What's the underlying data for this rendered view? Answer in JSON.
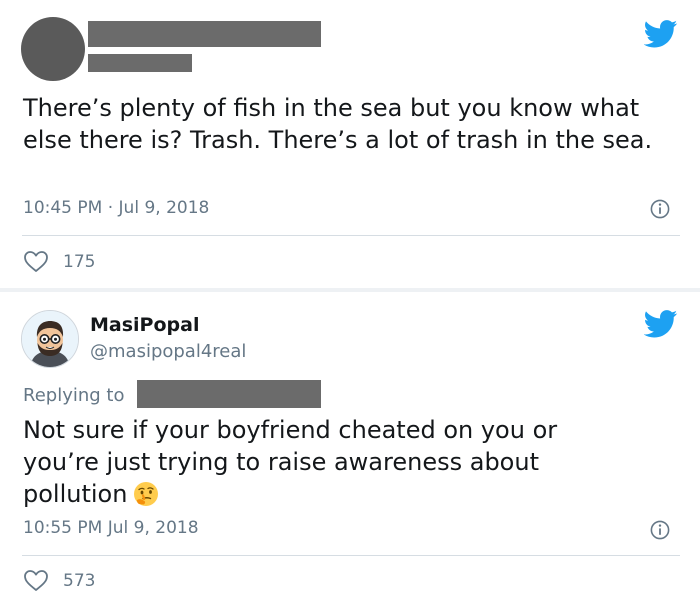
{
  "tweet1": {
    "text": "There’s plenty of fish in the sea but you know what else there is? Trash. There’s a lot of trash in the sea.",
    "time": "10:45 PM",
    "separator": "·",
    "date": "Jul 9, 2018",
    "likes": "175"
  },
  "tweet2": {
    "display_name": "MasiPopal",
    "handle": "@masipopal4real",
    "replying_to_label": "Replying to",
    "text": "Not sure if your boyfriend cheated on you or you’re just trying to raise awareness about pollution",
    "emoji": "thinking-face",
    "time": "10:55 PM",
    "date": "Jul 9, 2018",
    "likes": "573"
  },
  "colors": {
    "twitter_blue": "#1da1f2",
    "meta_gray": "#657786",
    "redaction_gray": "#6b6b6b"
  }
}
